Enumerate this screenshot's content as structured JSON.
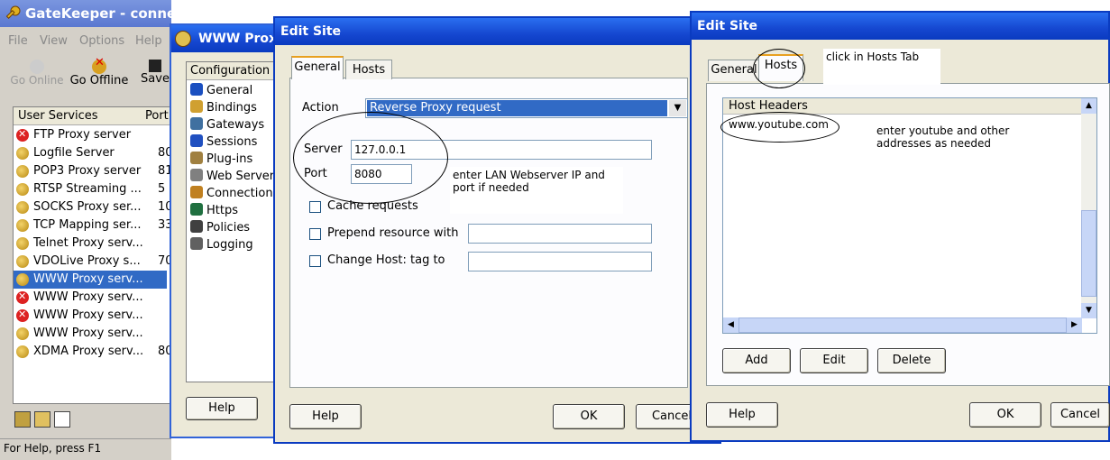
{
  "gatekeeper": {
    "title": "GateKeeper - connected to WinGate",
    "menu": [
      "File",
      "View",
      "Options",
      "Help"
    ],
    "toolbar": {
      "go_online": "Go Online",
      "go_offline": "Go Offline",
      "save": "Save"
    },
    "services_header": {
      "col1": "User Services",
      "col2": "Port"
    },
    "services": [
      {
        "name": "FTP Proxy server",
        "port": "",
        "icon": "error-icon"
      },
      {
        "name": "Logfile Server",
        "port": "80",
        "icon": "service-icon"
      },
      {
        "name": "POP3 Proxy server",
        "port": "81",
        "icon": "service-icon"
      },
      {
        "name": "RTSP Streaming ...",
        "port": "5",
        "icon": "service-icon"
      },
      {
        "name": "SOCKS Proxy ser...",
        "port": "10",
        "icon": "service-icon"
      },
      {
        "name": "TCP Mapping ser...",
        "port": "33",
        "icon": "service-icon"
      },
      {
        "name": "Telnet Proxy serv...",
        "port": "",
        "icon": "service-icon"
      },
      {
        "name": "VDOLive Proxy s...",
        "port": "70",
        "icon": "service-icon"
      },
      {
        "name": "WWW Proxy serv...",
        "port": "",
        "icon": "service-icon",
        "selected": true
      },
      {
        "name": "WWW Proxy serv...",
        "port": "",
        "icon": "error-icon"
      },
      {
        "name": "WWW Proxy serv...",
        "port": "",
        "icon": "error-icon"
      },
      {
        "name": "WWW Proxy serv...",
        "port": "",
        "icon": "service-icon"
      },
      {
        "name": "XDMA Proxy serv...",
        "port": "80",
        "icon": "service-icon"
      }
    ],
    "status": "For Help, press F1"
  },
  "www_proxy": {
    "title": "WWW Proxy",
    "config_label": "Configuration",
    "items": [
      "General",
      "Bindings",
      "Gateways",
      "Sessions",
      "Plug-ins",
      "Web Server",
      "Connection",
      "Https",
      "Policies",
      "Logging"
    ],
    "help": "Help"
  },
  "edit_site_1": {
    "title": "Edit Site",
    "tabs": [
      "General",
      "Hosts"
    ],
    "action_label": "Action",
    "action_value": "Reverse Proxy request",
    "server_label": "Server",
    "server_value": "127.0.0.1",
    "port_label": "Port",
    "port_value": "8080",
    "cache_label": "Cache requests",
    "prepend_label": "Prepend resource with",
    "change_host_label": "Change Host: tag to",
    "help": "Help",
    "ok": "OK",
    "cancel": "Cancel",
    "note": "enter LAN Webserver IP and port if needed"
  },
  "edit_site_2": {
    "title": "Edit Site",
    "tabs": [
      "General",
      "Hosts"
    ],
    "host_headers_label": "Host Headers",
    "host_entry": "www.youtube.com",
    "add": "Add",
    "edit": "Edit",
    "delete": "Delete",
    "help": "Help",
    "ok": "OK",
    "cancel": "Cancel",
    "note_hosts": "click in Hosts Tab",
    "note_youtube": "enter youtube and other addresses as needed"
  },
  "colors": {
    "titlebar": "#1547d0",
    "dialog": "#ece9d8",
    "selection": "#316ac5"
  }
}
